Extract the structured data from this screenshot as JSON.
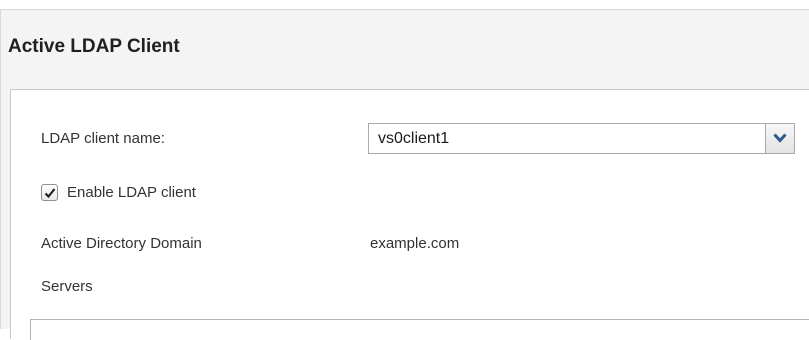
{
  "dialog": {
    "title": "Active LDAP Client"
  },
  "form": {
    "client_name_label": "LDAP client name:",
    "client_name_value": "vs0client1",
    "enable_label": "Enable LDAP client",
    "enable_checked": true,
    "domain_label": "Active Directory Domain",
    "domain_value": "example.com",
    "servers_label": "Servers"
  },
  "icons": {
    "dropdown": "chevron-down-icon",
    "checkbox": "checkmark-icon"
  },
  "colors": {
    "dropdown_arrow": "#2d5d8c",
    "dialog_background": "#f4f4f4",
    "panel_background": "#ffffff"
  }
}
